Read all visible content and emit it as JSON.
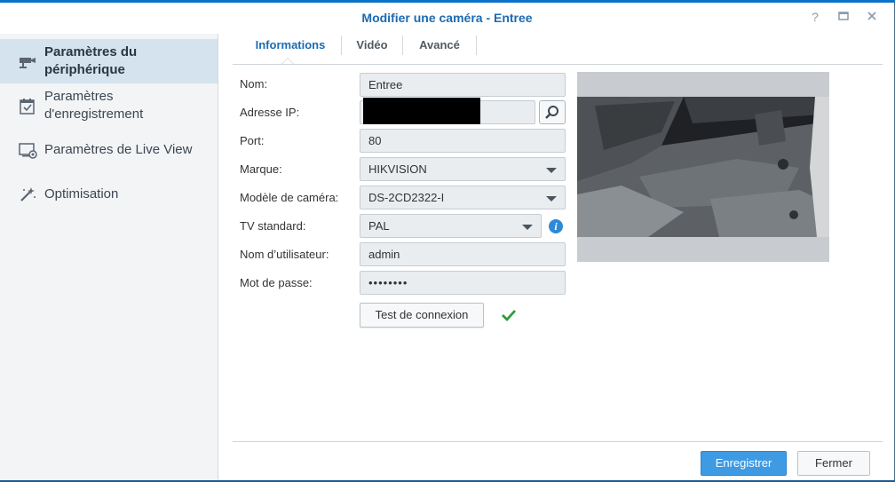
{
  "window": {
    "title": "Modifier une caméra - Entree"
  },
  "sidebar": {
    "items": [
      {
        "label": "Paramètres du périphérique",
        "icon": "camera-icon",
        "active": true
      },
      {
        "label": "Paramètres d'enregistrement",
        "icon": "calendar-check-icon",
        "active": false
      },
      {
        "label": "Paramètres de Live View",
        "icon": "live-view-icon",
        "active": false
      },
      {
        "label": "Optimisation",
        "icon": "magic-wand-icon",
        "active": false
      }
    ]
  },
  "tabs": [
    {
      "label": "Informations",
      "active": true
    },
    {
      "label": "Vidéo",
      "active": false
    },
    {
      "label": "Avancé",
      "active": false
    }
  ],
  "form": {
    "name_label": "Nom:",
    "name_value": "Entree",
    "ip_label": "Adresse IP:",
    "port_label": "Port:",
    "port_value": "80",
    "brand_label": "Marque:",
    "brand_value": "HIKVISION",
    "model_label": "Modèle de caméra:",
    "model_value": "DS-2CD2322-I",
    "tv_label": "TV standard:",
    "tv_value": "PAL",
    "user_label": "Nom d’utilisateur:",
    "user_value": "admin",
    "password_label": "Mot de passe:",
    "password_value": "••••••••",
    "test_button": "Test de connexion"
  },
  "footer": {
    "save_label": "Enregistrer",
    "close_label": "Fermer"
  },
  "colors": {
    "accent": "#1b6bb3",
    "primary_button": "#3d9ae3",
    "success": "#2e9b3a",
    "sidebar_active": "#d4e3ed"
  }
}
